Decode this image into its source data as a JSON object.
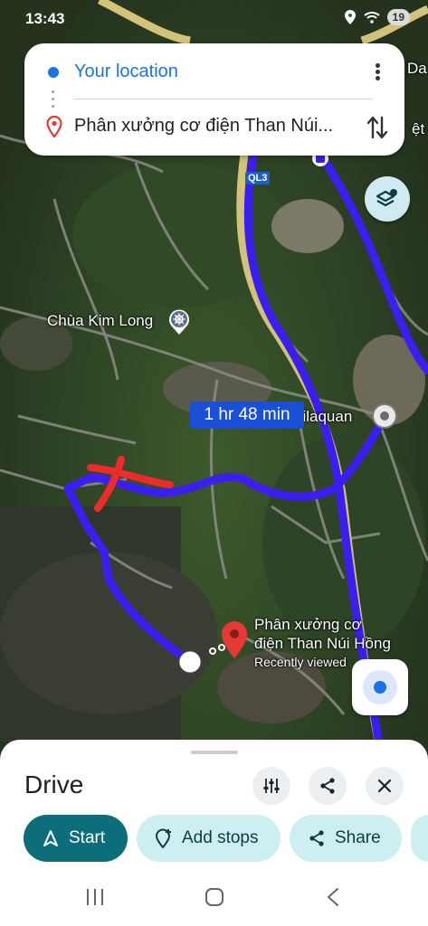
{
  "status_bar": {
    "time": "13:43",
    "battery": "19"
  },
  "route_card": {
    "origin": "Your location",
    "destination": "Phân xưởng cơ điện Than Núi..."
  },
  "map": {
    "route_color": "#3b1ef2",
    "place_kim_long": "Chùa Kim Long",
    "duration": "1 hr 48 min",
    "place_bilaquan": "bilaquan",
    "road_shield": "QL3",
    "dest_line1": "Phân xưởng cơ",
    "dest_line2": "điện Than Núi Hồng",
    "dest_sub": "Recently viewed",
    "edge_text_1": "Da",
    "edge_text_2": "ệt"
  },
  "sheet": {
    "title": "Drive",
    "start_label": "Start",
    "add_stops_label": "Add stops",
    "share_label": "Share"
  },
  "colors": {
    "accent": "#1a73e8",
    "primary_button": "#0b6e7a",
    "tonal_button": "#cdeff2"
  }
}
